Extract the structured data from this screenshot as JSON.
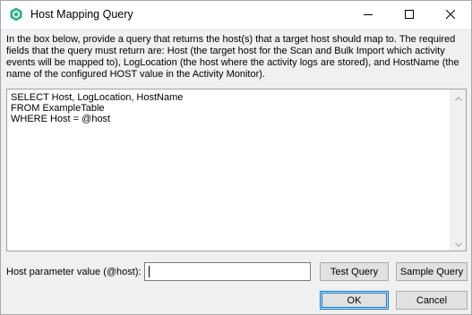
{
  "window": {
    "title": "Host Mapping Query",
    "icon": "app-hexagon-icon",
    "accent_color": "#2cb08a"
  },
  "titlebar_controls": {
    "minimize": "minimize-icon",
    "maximize": "maximize-icon",
    "close": "close-icon"
  },
  "instructions": "In the box below, provide a query that returns the host(s) that a target host should map to. The required fields that the query must return are: Host (the target host for the Scan and Bulk Import which activity events will be mapped to), LogLocation (the host where the activity logs are stored), and HostName (the name of the configured HOST value in the Activity Monitor).",
  "query": {
    "text": "SELECT Host, LogLocation, HostName\nFROM ExampleTable\nWHERE Host = @host"
  },
  "host_param": {
    "label": "Host parameter value (@host):",
    "value": ""
  },
  "buttons": {
    "test_query": "Test Query",
    "sample_query": "Sample Query",
    "ok": "OK",
    "cancel": "Cancel"
  }
}
